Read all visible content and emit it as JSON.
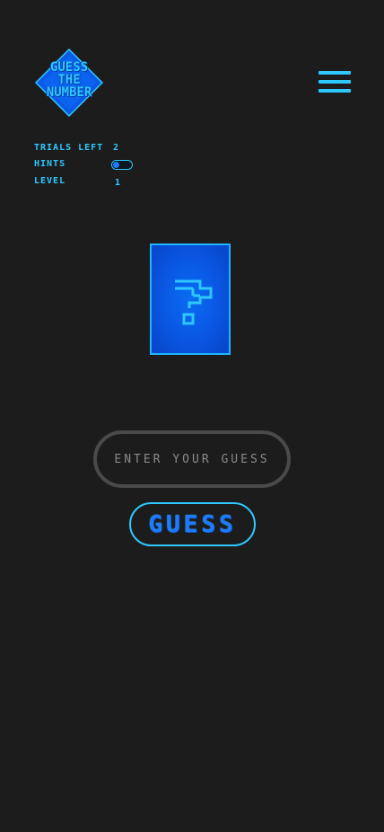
{
  "logo": {
    "lines": [
      "GUESS",
      "THE",
      "NUMBER"
    ]
  },
  "menu": {
    "icon": "hamburger-menu-icon"
  },
  "stats": {
    "trials_label": "TRIALS LEFT",
    "trials_value": "2",
    "hints_label": "HINTS",
    "hints_enabled": false,
    "level_label": "LEVEL",
    "level_value": "1"
  },
  "card": {
    "icon": "question-mark-icon"
  },
  "input": {
    "placeholder": "ENTER YOUR GUESS",
    "value": ""
  },
  "button": {
    "label": "GUESS"
  },
  "colors": {
    "background": "#1c1c1c",
    "accent": "#2ec8ff",
    "primary_blue": "#1e7bff",
    "card_blue": "#0a5ae6",
    "input_border": "#4a4a4a"
  }
}
